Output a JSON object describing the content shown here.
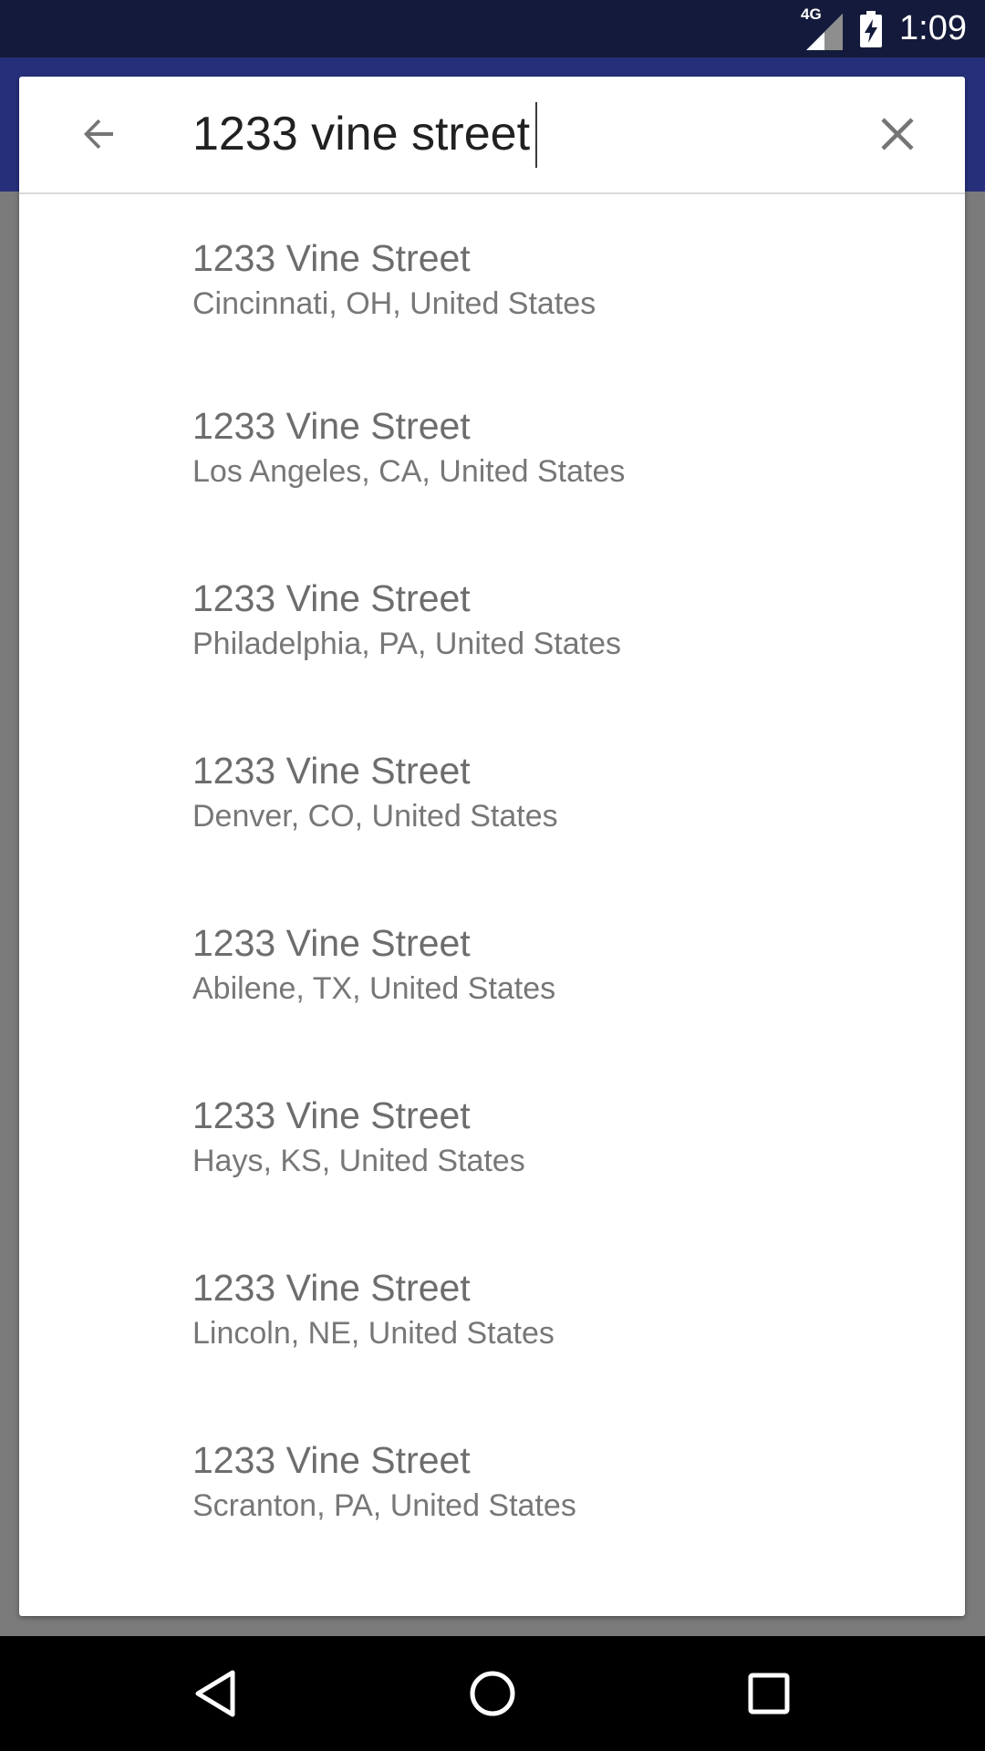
{
  "status_bar": {
    "network_type": "4G",
    "time": "1:09",
    "icons": [
      "signal-icon",
      "battery-charging-icon"
    ]
  },
  "search": {
    "query": "1233 vine street",
    "back_icon": "arrow-back-icon",
    "clear_icon": "close-icon"
  },
  "results": [
    {
      "title": "1233 Vine Street",
      "subtitle": "Cincinnati, OH, United States"
    },
    {
      "title": "1233 Vine Street",
      "subtitle": "Los Angeles, CA, United States"
    },
    {
      "title": "1233 Vine Street",
      "subtitle": "Philadelphia, PA, United States"
    },
    {
      "title": "1233 Vine Street",
      "subtitle": "Denver, CO, United States"
    },
    {
      "title": "1233 Vine Street",
      "subtitle": "Abilene, TX, United States"
    },
    {
      "title": "1233 Vine Street",
      "subtitle": "Hays, KS, United States"
    },
    {
      "title": "1233 Vine Street",
      "subtitle": "Lincoln, NE, United States"
    },
    {
      "title": "1233 Vine Street",
      "subtitle": "Scranton, PA, United States"
    }
  ],
  "nav_bar": {
    "icons": [
      "back-triangle-icon",
      "home-circle-icon",
      "recents-square-icon"
    ]
  },
  "colors": {
    "status_bar": "#141a3b",
    "app_bar": "#26307a",
    "scrim": "#7b7b7b",
    "card": "#ffffff"
  }
}
